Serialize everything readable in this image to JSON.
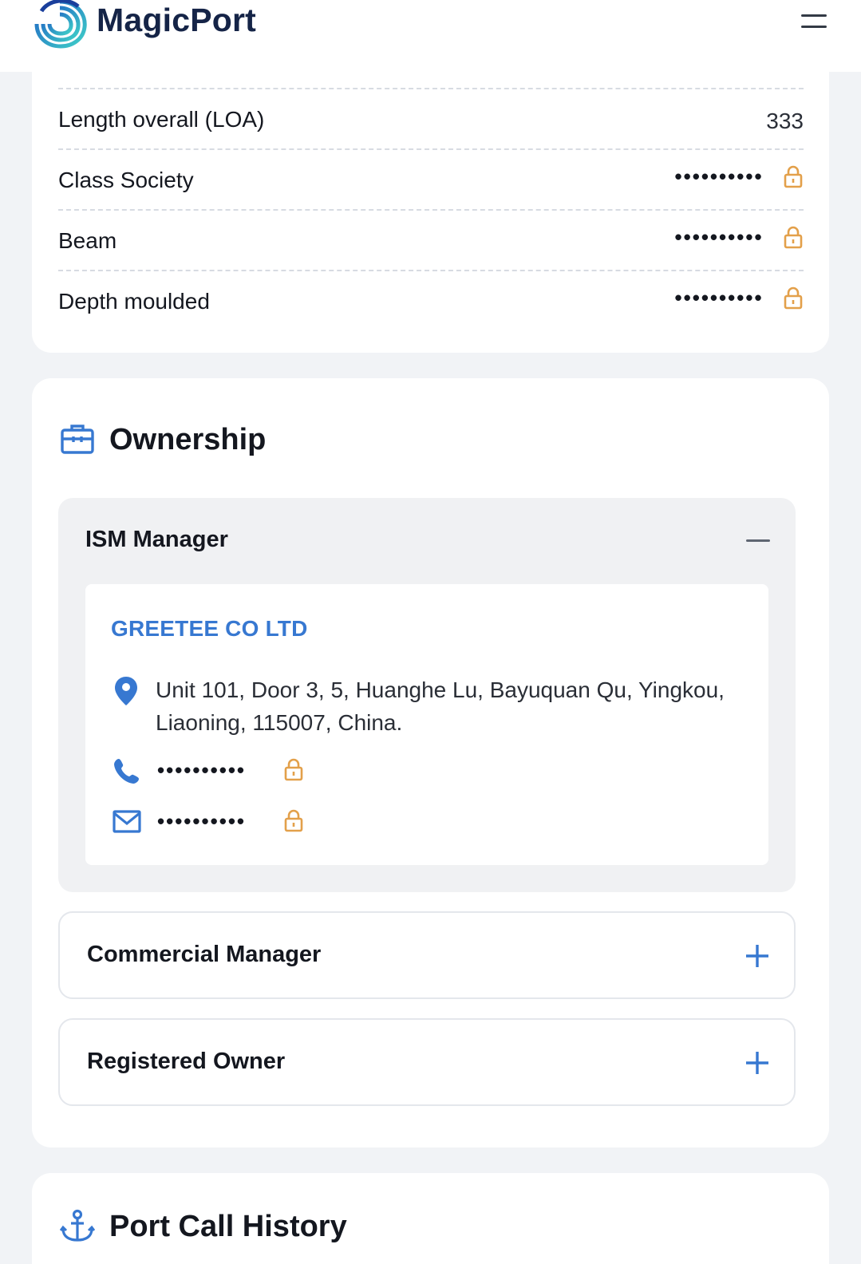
{
  "header": {
    "brand": "MagicPort",
    "logo_icon": "magicport-swirl-logo",
    "menu_icon": "hamburger-menu-icon"
  },
  "specs": {
    "rows": [
      {
        "label": "Length overall (LOA)",
        "value": "333",
        "locked": false
      },
      {
        "label": "Class Society",
        "value": "••••••••••",
        "locked": true
      },
      {
        "label": "Beam",
        "value": "••••••••••",
        "locked": true
      },
      {
        "label": "Depth moulded",
        "value": "••••••••••",
        "locked": true
      }
    ]
  },
  "ownership": {
    "title": "Ownership",
    "icon": "briefcase-icon",
    "ism_manager": {
      "label": "ISM Manager",
      "expanded": true,
      "company": "GREETEE CO LTD",
      "address": "Unit 101, Door 3, 5, Huanghe Lu, Bayuquan Qu, Yingkou, Liaoning, 115007, China.",
      "phone": "••••••••••",
      "email": "••••••••••"
    },
    "commercial_manager": {
      "label": "Commercial Manager",
      "expanded": false
    },
    "registered_owner": {
      "label": "Registered Owner",
      "expanded": false
    }
  },
  "port_call_history": {
    "title": "Port Call History",
    "icon": "anchor-icon"
  },
  "colors": {
    "accent_blue": "#3778d1",
    "lock_orange": "#e3a04a",
    "brand_navy": "#152447"
  }
}
